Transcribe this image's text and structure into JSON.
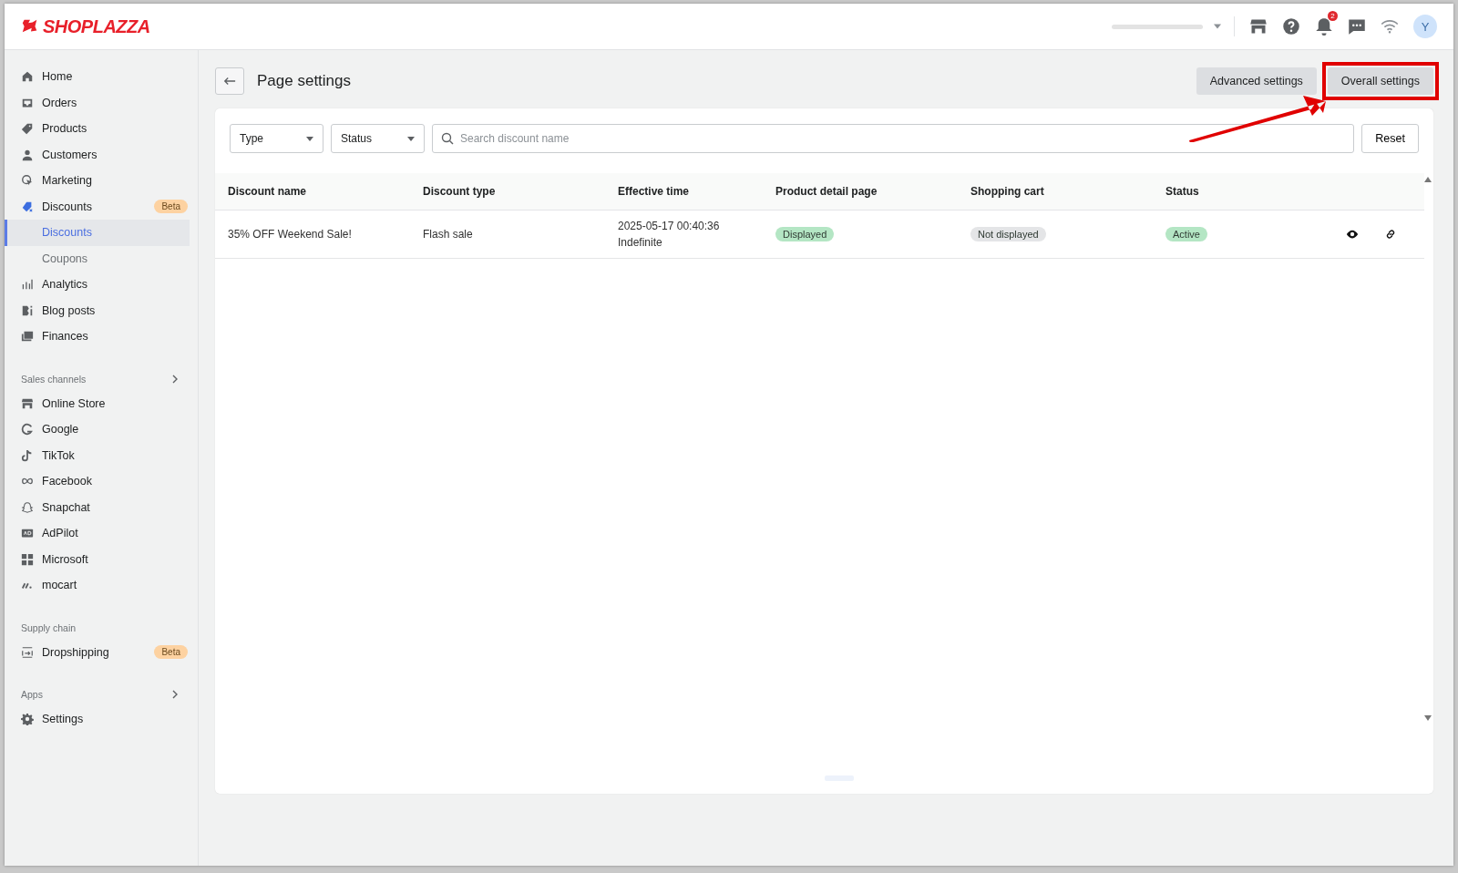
{
  "header": {
    "brand": "SHOPLAZZA",
    "notifications_count": "2",
    "avatar_initial": "Y"
  },
  "sidebar": {
    "items": [
      {
        "kind": "item",
        "label": "Home",
        "selected": false
      },
      {
        "kind": "item",
        "label": "Orders",
        "selected": false
      },
      {
        "kind": "item",
        "label": "Products",
        "selected": false
      },
      {
        "kind": "item",
        "label": "Customers",
        "selected": false
      },
      {
        "kind": "item",
        "label": "Marketing",
        "selected": false
      },
      {
        "kind": "item",
        "label": "Discounts",
        "selected": false,
        "badge": "Beta"
      },
      {
        "kind": "subitem",
        "label": "Discounts",
        "selected": true
      },
      {
        "kind": "subitem",
        "label": "Coupons",
        "selected": false
      },
      {
        "kind": "item",
        "label": "Analytics",
        "selected": false
      },
      {
        "kind": "item",
        "label": "Blog posts",
        "selected": false
      },
      {
        "kind": "item",
        "label": "Finances",
        "selected": false
      },
      {
        "kind": "section",
        "label": "Sales channels",
        "expandable": true
      },
      {
        "kind": "item",
        "label": "Online Store",
        "selected": false
      },
      {
        "kind": "item",
        "label": "Google",
        "selected": false
      },
      {
        "kind": "item",
        "label": "TikTok",
        "selected": false
      },
      {
        "kind": "item",
        "label": "Facebook",
        "selected": false
      },
      {
        "kind": "item",
        "label": "Snapchat",
        "selected": false
      },
      {
        "kind": "item",
        "label": "AdPilot",
        "selected": false
      },
      {
        "kind": "item",
        "label": "Microsoft",
        "selected": false
      },
      {
        "kind": "item",
        "label": "mocart",
        "selected": false
      },
      {
        "kind": "section",
        "label": "Supply chain",
        "expandable": false
      },
      {
        "kind": "item",
        "label": "Dropshipping",
        "selected": false,
        "badge": "Beta"
      },
      {
        "kind": "section",
        "label": "Apps",
        "expandable": true
      },
      {
        "kind": "item",
        "label": "Settings",
        "selected": false
      }
    ]
  },
  "page": {
    "title": "Page settings",
    "buttons": [
      {
        "label": "Advanced settings",
        "highlighted": false
      },
      {
        "label": "Overall settings",
        "highlighted": true
      }
    ]
  },
  "filters": {
    "type": "Type",
    "status": "Status",
    "search_placeholder": "Search discount name",
    "reset": "Reset"
  },
  "table": {
    "columns": [
      "Discount name",
      "Discount type",
      "Effective time",
      "Product detail page",
      "Shopping cart",
      "Status"
    ],
    "rows": [
      {
        "name": "35% OFF Weekend Sale!",
        "type": "Flash sale",
        "time_start": "2025-05-17 00:40:36",
        "time_end": "Indefinite",
        "product_page": {
          "text": "Displayed",
          "color": "#b4e6c4"
        },
        "cart": {
          "text": "Not displayed",
          "color": "#e4e5e7"
        },
        "status": {
          "text": "Active",
          "color": "#b4e6c4"
        }
      }
    ]
  }
}
